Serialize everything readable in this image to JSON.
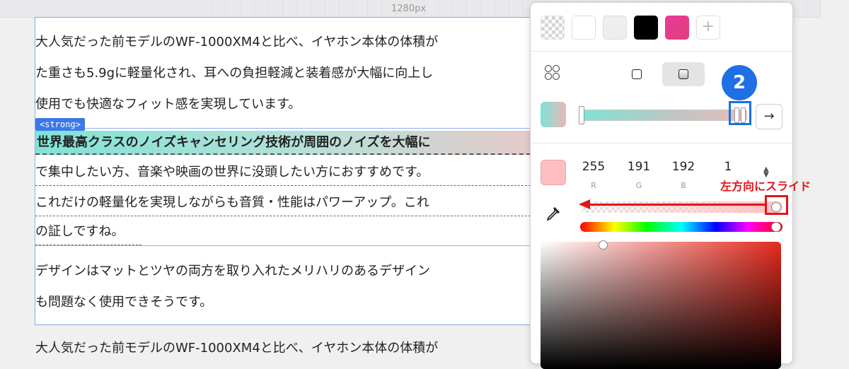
{
  "ruler": {
    "label": "1280px"
  },
  "document": {
    "paragraph1": [
      "大人気だった前モデルのWF-1000XM4と比べ、イヤホン本体の体積が",
      "た重さも5.9gに軽量化され、耳への負担軽減と装着感が大幅に向上し",
      "使用でも快適なフィット感を実現しています。"
    ],
    "strong_tag": "<strong>",
    "strong_text": "世界最高クラスのノイズキャンセリング技術が周囲のノイズを大幅に",
    "paragraph2": [
      "で集中したい方、音楽や映画の世界に没頭したい方におすすめです。",
      "これだけの軽量化を実現しながらも音質・性能はパワーアップ。これ",
      "の証しですね。"
    ],
    "paragraph3": [
      "デザインはマットとツヤの両方を取り入れたメリハリのあるデザイン",
      "も問題なく使用できそうです。"
    ],
    "paragraph4": "大人気だった前モデルのWF-1000XM4と比べ、イヤホン本体の体積が"
  },
  "color_panel": {
    "swatches": [
      {
        "name": "transparent",
        "color": "transparent"
      },
      {
        "name": "white",
        "color": "#ffffff"
      },
      {
        "name": "light-gray",
        "color": "#eeeeee"
      },
      {
        "name": "black",
        "color": "#000000"
      },
      {
        "name": "pink",
        "color": "#e8399a"
      }
    ],
    "add_swatch_label": "+",
    "arrow_label": "→",
    "rgba": {
      "r": "255",
      "g": "191",
      "b": "192",
      "a": "1",
      "r_label": "R",
      "g_label": "G",
      "b_label": "B"
    },
    "gradient_start": "#7ee3d6",
    "gradient_end": "#e8bcbc",
    "current_color": "#ffbfc0",
    "alpha_level": 1,
    "hue_level": 1
  },
  "annotations": {
    "step_badge": "2",
    "slide_label": "左方向にスライド",
    "accent_red": "#e0161b",
    "accent_blue": "#1f6fe6"
  }
}
